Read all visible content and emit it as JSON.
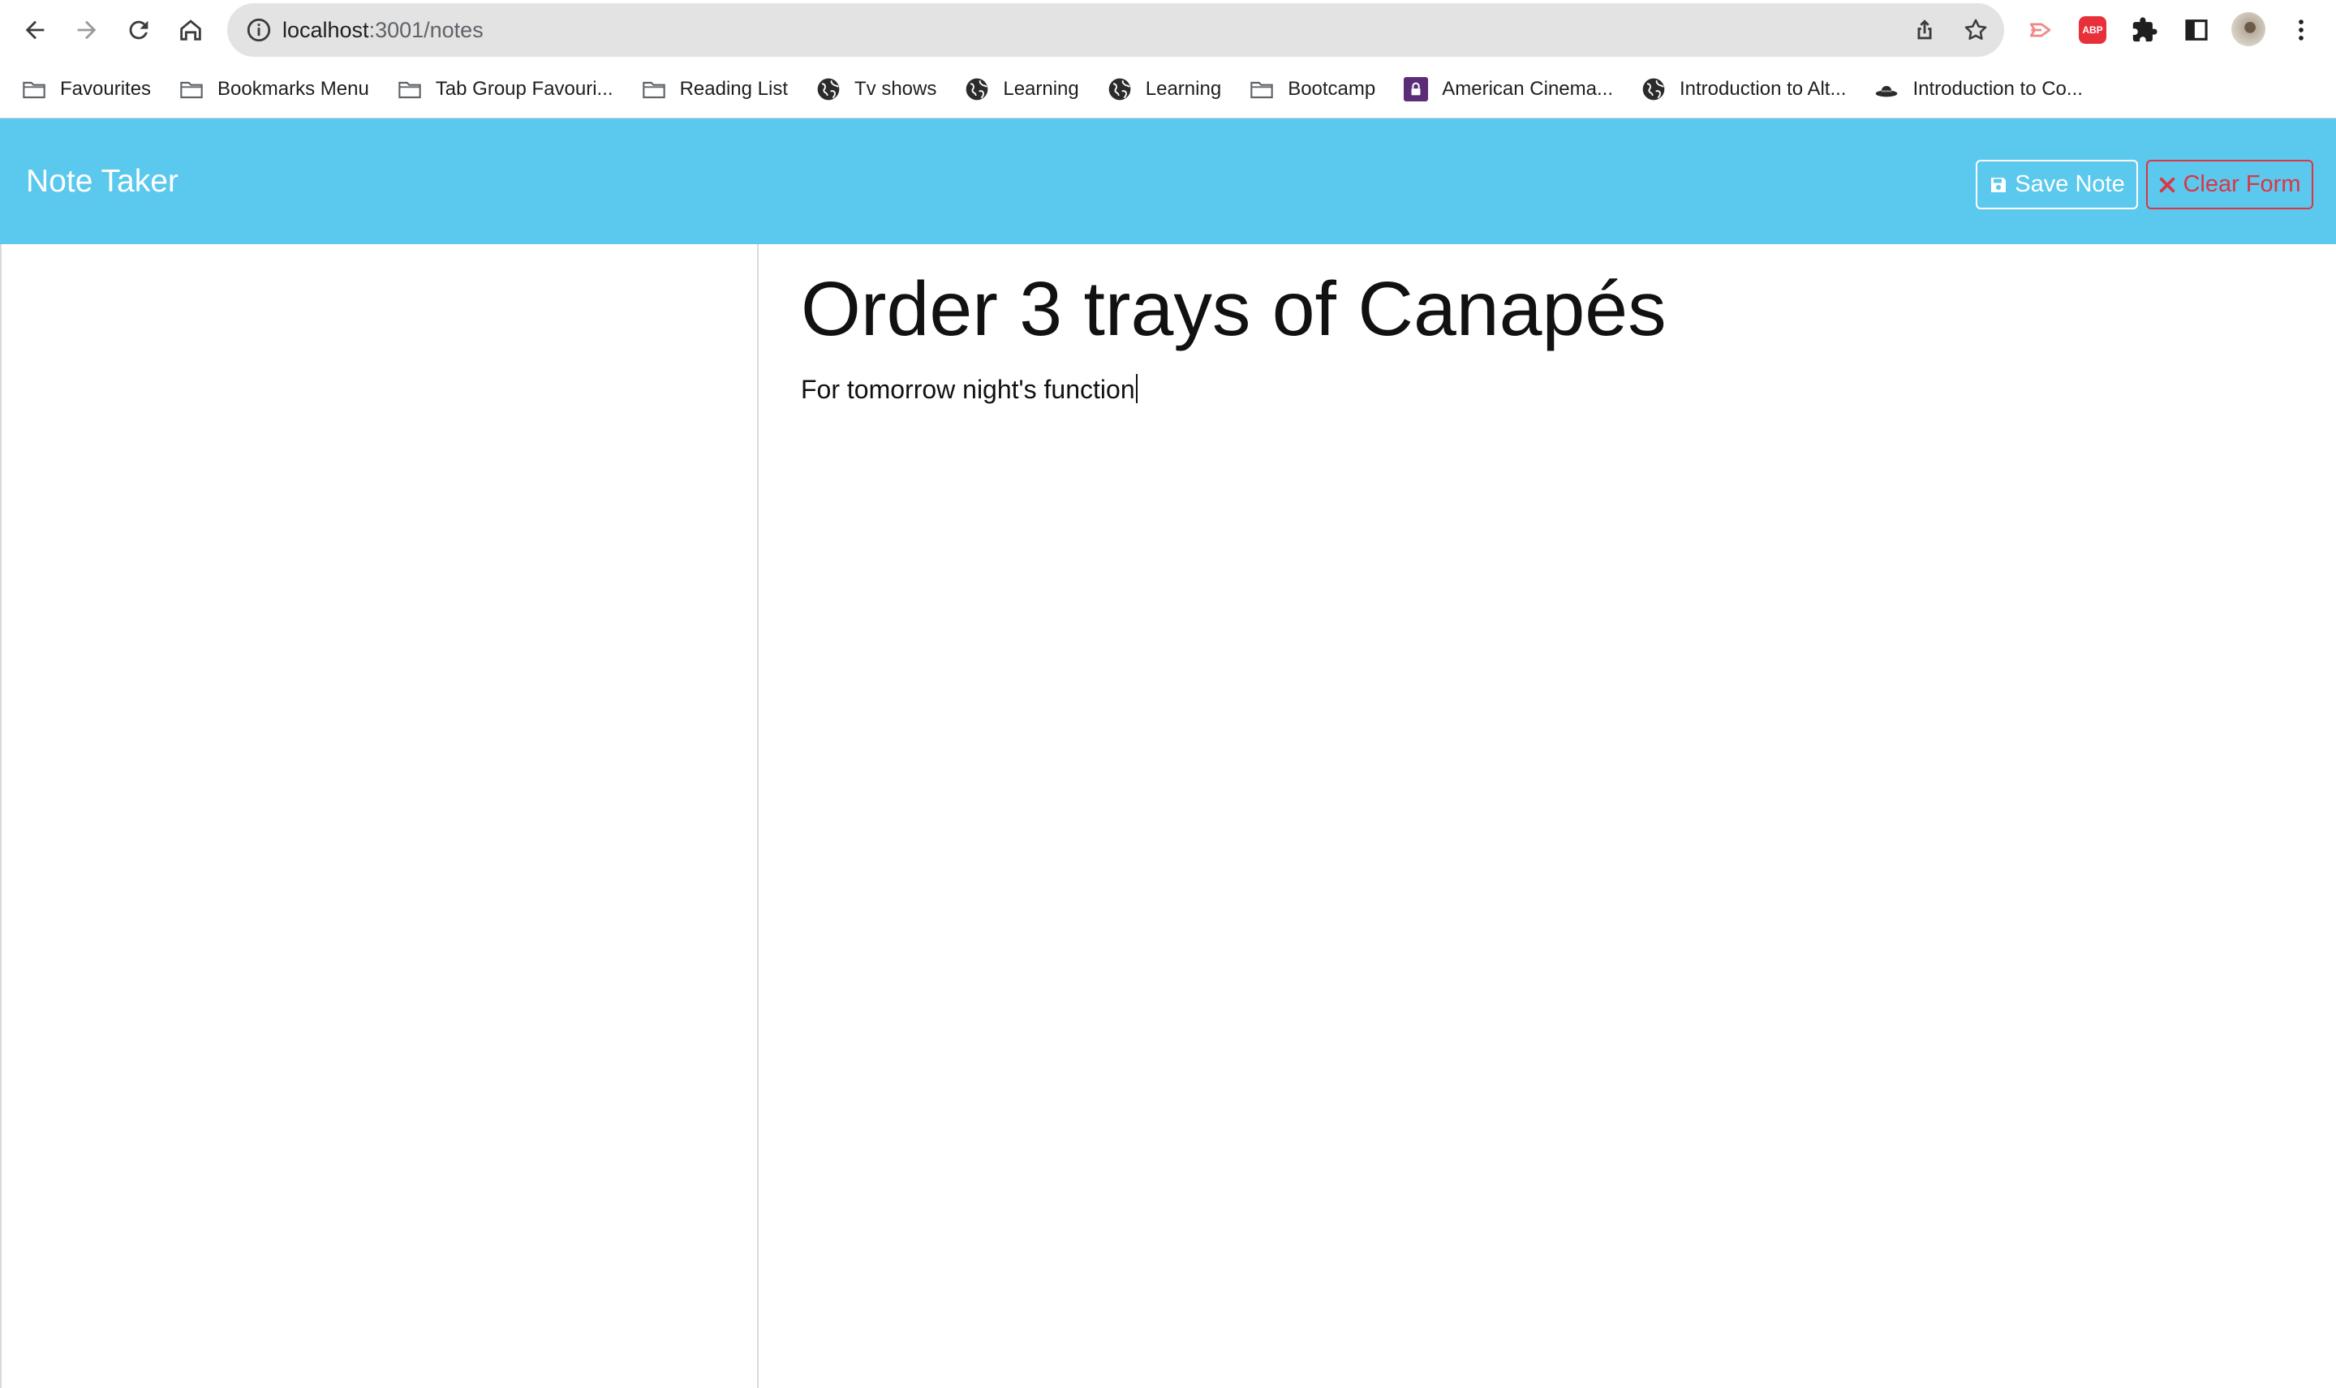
{
  "browser": {
    "url_host": "localhost",
    "url_path": ":3001/notes",
    "nav_icons": [
      "back-icon",
      "forward-icon",
      "reload-icon",
      "home-icon"
    ],
    "omnibox_icons": [
      "info-icon",
      "share-icon",
      "star-icon"
    ],
    "extension_icons": [
      "media-cast-icon",
      "adblock-icon",
      "puzzle-icon",
      "side-panel-icon",
      "more-icon"
    ],
    "abp_label": "ABP"
  },
  "bookmarks": [
    {
      "label": "Favourites",
      "icon": "folder-icon"
    },
    {
      "label": "Bookmarks Menu",
      "icon": "folder-icon"
    },
    {
      "label": "Tab Group Favouri...",
      "icon": "folder-icon"
    },
    {
      "label": "Reading List",
      "icon": "folder-icon"
    },
    {
      "label": "Tv shows",
      "icon": "globe-icon"
    },
    {
      "label": "Learning",
      "icon": "globe-icon"
    },
    {
      "label": "Learning",
      "icon": "globe-icon"
    },
    {
      "label": "Bootcamp",
      "icon": "folder-icon"
    },
    {
      "label": "American Cinema...",
      "icon": "lock-icon"
    },
    {
      "label": "Introduction to Alt...",
      "icon": "globe-icon"
    },
    {
      "label": "Introduction to Co...",
      "icon": "hat-icon"
    }
  ],
  "app": {
    "brand": "Note Taker",
    "save_label": "Save Note",
    "clear_label": "Clear Form"
  },
  "note": {
    "title": "Order 3 trays of Canapés",
    "text": "For tomorrow night's function"
  },
  "colors": {
    "navbar": "#5bc8ed",
    "danger": "#dc3545",
    "omnibox": "#e3e3e3"
  }
}
